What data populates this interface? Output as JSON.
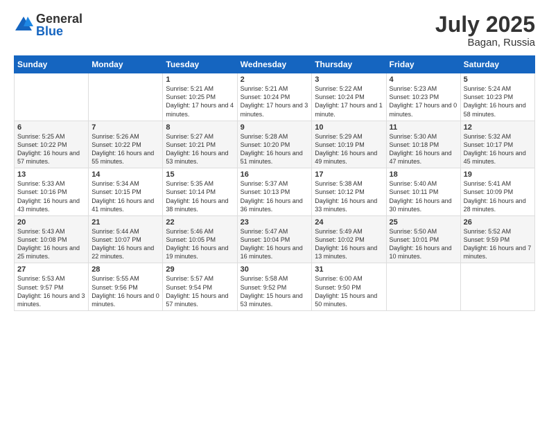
{
  "logo": {
    "general": "General",
    "blue": "Blue"
  },
  "title": "July 2025",
  "location": "Bagan, Russia",
  "headers": [
    "Sunday",
    "Monday",
    "Tuesday",
    "Wednesday",
    "Thursday",
    "Friday",
    "Saturday"
  ],
  "weeks": [
    [
      {
        "day": "",
        "sunrise": "",
        "sunset": "",
        "daylight": ""
      },
      {
        "day": "",
        "sunrise": "",
        "sunset": "",
        "daylight": ""
      },
      {
        "day": "1",
        "sunrise": "Sunrise: 5:21 AM",
        "sunset": "Sunset: 10:25 PM",
        "daylight": "Daylight: 17 hours and 4 minutes."
      },
      {
        "day": "2",
        "sunrise": "Sunrise: 5:21 AM",
        "sunset": "Sunset: 10:24 PM",
        "daylight": "Daylight: 17 hours and 3 minutes."
      },
      {
        "day": "3",
        "sunrise": "Sunrise: 5:22 AM",
        "sunset": "Sunset: 10:24 PM",
        "daylight": "Daylight: 17 hours and 1 minute."
      },
      {
        "day": "4",
        "sunrise": "Sunrise: 5:23 AM",
        "sunset": "Sunset: 10:23 PM",
        "daylight": "Daylight: 17 hours and 0 minutes."
      },
      {
        "day": "5",
        "sunrise": "Sunrise: 5:24 AM",
        "sunset": "Sunset: 10:23 PM",
        "daylight": "Daylight: 16 hours and 58 minutes."
      }
    ],
    [
      {
        "day": "6",
        "sunrise": "Sunrise: 5:25 AM",
        "sunset": "Sunset: 10:22 PM",
        "daylight": "Daylight: 16 hours and 57 minutes."
      },
      {
        "day": "7",
        "sunrise": "Sunrise: 5:26 AM",
        "sunset": "Sunset: 10:22 PM",
        "daylight": "Daylight: 16 hours and 55 minutes."
      },
      {
        "day": "8",
        "sunrise": "Sunrise: 5:27 AM",
        "sunset": "Sunset: 10:21 PM",
        "daylight": "Daylight: 16 hours and 53 minutes."
      },
      {
        "day": "9",
        "sunrise": "Sunrise: 5:28 AM",
        "sunset": "Sunset: 10:20 PM",
        "daylight": "Daylight: 16 hours and 51 minutes."
      },
      {
        "day": "10",
        "sunrise": "Sunrise: 5:29 AM",
        "sunset": "Sunset: 10:19 PM",
        "daylight": "Daylight: 16 hours and 49 minutes."
      },
      {
        "day": "11",
        "sunrise": "Sunrise: 5:30 AM",
        "sunset": "Sunset: 10:18 PM",
        "daylight": "Daylight: 16 hours and 47 minutes."
      },
      {
        "day": "12",
        "sunrise": "Sunrise: 5:32 AM",
        "sunset": "Sunset: 10:17 PM",
        "daylight": "Daylight: 16 hours and 45 minutes."
      }
    ],
    [
      {
        "day": "13",
        "sunrise": "Sunrise: 5:33 AM",
        "sunset": "Sunset: 10:16 PM",
        "daylight": "Daylight: 16 hours and 43 minutes."
      },
      {
        "day": "14",
        "sunrise": "Sunrise: 5:34 AM",
        "sunset": "Sunset: 10:15 PM",
        "daylight": "Daylight: 16 hours and 41 minutes."
      },
      {
        "day": "15",
        "sunrise": "Sunrise: 5:35 AM",
        "sunset": "Sunset: 10:14 PM",
        "daylight": "Daylight: 16 hours and 38 minutes."
      },
      {
        "day": "16",
        "sunrise": "Sunrise: 5:37 AM",
        "sunset": "Sunset: 10:13 PM",
        "daylight": "Daylight: 16 hours and 36 minutes."
      },
      {
        "day": "17",
        "sunrise": "Sunrise: 5:38 AM",
        "sunset": "Sunset: 10:12 PM",
        "daylight": "Daylight: 16 hours and 33 minutes."
      },
      {
        "day": "18",
        "sunrise": "Sunrise: 5:40 AM",
        "sunset": "Sunset: 10:11 PM",
        "daylight": "Daylight: 16 hours and 30 minutes."
      },
      {
        "day": "19",
        "sunrise": "Sunrise: 5:41 AM",
        "sunset": "Sunset: 10:09 PM",
        "daylight": "Daylight: 16 hours and 28 minutes."
      }
    ],
    [
      {
        "day": "20",
        "sunrise": "Sunrise: 5:43 AM",
        "sunset": "Sunset: 10:08 PM",
        "daylight": "Daylight: 16 hours and 25 minutes."
      },
      {
        "day": "21",
        "sunrise": "Sunrise: 5:44 AM",
        "sunset": "Sunset: 10:07 PM",
        "daylight": "Daylight: 16 hours and 22 minutes."
      },
      {
        "day": "22",
        "sunrise": "Sunrise: 5:46 AM",
        "sunset": "Sunset: 10:05 PM",
        "daylight": "Daylight: 16 hours and 19 minutes."
      },
      {
        "day": "23",
        "sunrise": "Sunrise: 5:47 AM",
        "sunset": "Sunset: 10:04 PM",
        "daylight": "Daylight: 16 hours and 16 minutes."
      },
      {
        "day": "24",
        "sunrise": "Sunrise: 5:49 AM",
        "sunset": "Sunset: 10:02 PM",
        "daylight": "Daylight: 16 hours and 13 minutes."
      },
      {
        "day": "25",
        "sunrise": "Sunrise: 5:50 AM",
        "sunset": "Sunset: 10:01 PM",
        "daylight": "Daylight: 16 hours and 10 minutes."
      },
      {
        "day": "26",
        "sunrise": "Sunrise: 5:52 AM",
        "sunset": "Sunset: 9:59 PM",
        "daylight": "Daylight: 16 hours and 7 minutes."
      }
    ],
    [
      {
        "day": "27",
        "sunrise": "Sunrise: 5:53 AM",
        "sunset": "Sunset: 9:57 PM",
        "daylight": "Daylight: 16 hours and 3 minutes."
      },
      {
        "day": "28",
        "sunrise": "Sunrise: 5:55 AM",
        "sunset": "Sunset: 9:56 PM",
        "daylight": "Daylight: 16 hours and 0 minutes."
      },
      {
        "day": "29",
        "sunrise": "Sunrise: 5:57 AM",
        "sunset": "Sunset: 9:54 PM",
        "daylight": "Daylight: 15 hours and 57 minutes."
      },
      {
        "day": "30",
        "sunrise": "Sunrise: 5:58 AM",
        "sunset": "Sunset: 9:52 PM",
        "daylight": "Daylight: 15 hours and 53 minutes."
      },
      {
        "day": "31",
        "sunrise": "Sunrise: 6:00 AM",
        "sunset": "Sunset: 9:50 PM",
        "daylight": "Daylight: 15 hours and 50 minutes."
      },
      {
        "day": "",
        "sunrise": "",
        "sunset": "",
        "daylight": ""
      },
      {
        "day": "",
        "sunrise": "",
        "sunset": "",
        "daylight": ""
      }
    ]
  ]
}
